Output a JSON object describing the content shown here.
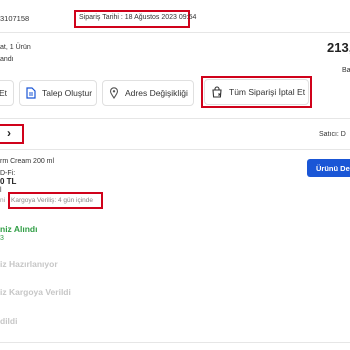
{
  "order": {
    "number_partial": "3107158",
    "date_label": "Sipariş Tarihi : 18 Ağustos 2023 09:54",
    "summary_partial": "at, 1 Ürün",
    "status_partial": "andı",
    "total_partial": "213,",
    "total_sub_partial": "Ba"
  },
  "actions": {
    "first_partial": "Et",
    "request_label": "Talep Oluştur",
    "address_label": "Adres Değişikliği",
    "cancel_all_label": "Tüm Siparişi İptal Et"
  },
  "seller": {
    "expand_glyph": "›",
    "seller_partial": "Satıcı: D"
  },
  "product": {
    "name_partial": "rm Cream 200 ml",
    "line2_partial": "D-Fi:",
    "price_partial": "0 TL",
    "line4_partial": "l",
    "cargo_prefix_partial": "ni",
    "cargo_label": "Kargoya Veriliş: 4 gün içinde",
    "action_label": "Ürünü Değ"
  },
  "timeline": {
    "received_label": "niz Alındı",
    "received_sub": "3",
    "preparing_label": "iz Hazırlanıyor",
    "shipped_label": "iz Kargoya Verildi",
    "delivered_label": "dildi"
  },
  "colors": {
    "accent_blue": "#1a56d6",
    "highlight_red": "#d0021b",
    "success_green": "#2f9e44",
    "inactive_grey": "#c6c6c6"
  }
}
